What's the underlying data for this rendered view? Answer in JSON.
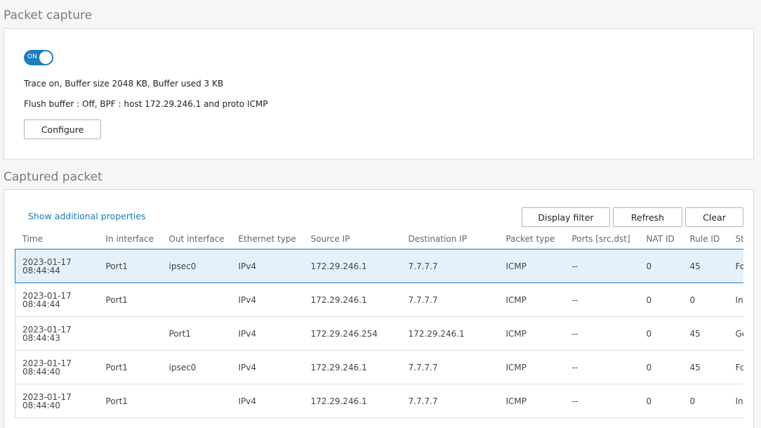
{
  "capture_section": {
    "title": "Packet capture",
    "toggle_label": "ON",
    "trace_status": "Trace on, Buffer size 2048 KB, Buffer used 3 KB",
    "buffer_status": "Flush buffer : Off, BPF : host 172.29.246.1 and proto ICMP",
    "configure_label": "Configure"
  },
  "captured_section": {
    "title": "Captured packet",
    "show_props_link": "Show additional properties",
    "display_filter_label": "Display filter",
    "refresh_label": "Refresh",
    "clear_label": "Clear",
    "columns": [
      "Time",
      "In interface",
      "Out interface",
      "Ethernet type",
      "Source IP",
      "Destination IP",
      "Packet type",
      "Ports [src,dst]",
      "NAT ID",
      "Rule ID",
      "Status"
    ],
    "rows": [
      {
        "date": "2023-01-17",
        "time": "08:44:44",
        "in": "Port1",
        "out": "ipsec0",
        "eth": "IPv4",
        "src": "172.29.246.1",
        "dst": "7.7.7.7",
        "ptype": "ICMP",
        "ports": "--",
        "nat": "0",
        "rule": "45",
        "status": "Forwarded"
      },
      {
        "date": "2023-01-17",
        "time": "08:44:44",
        "in": "Port1",
        "out": "",
        "eth": "IPv4",
        "src": "172.29.246.1",
        "dst": "7.7.7.7",
        "ptype": "ICMP",
        "ports": "--",
        "nat": "0",
        "rule": "0",
        "status": "Incoming"
      },
      {
        "date": "2023-01-17",
        "time": "08:44:43",
        "in": "",
        "out": "Port1",
        "eth": "IPv4",
        "src": "172.29.246.254",
        "dst": "172.29.246.1",
        "ptype": "ICMP",
        "ports": "--",
        "nat": "0",
        "rule": "45",
        "status": "Generated"
      },
      {
        "date": "2023-01-17",
        "time": "08:44:40",
        "in": "Port1",
        "out": "ipsec0",
        "eth": "IPv4",
        "src": "172.29.246.1",
        "dst": "7.7.7.7",
        "ptype": "ICMP",
        "ports": "--",
        "nat": "0",
        "rule": "45",
        "status": "Forwarded"
      },
      {
        "date": "2023-01-17",
        "time": "08:44:40",
        "in": "Port1",
        "out": "",
        "eth": "IPv4",
        "src": "172.29.246.1",
        "dst": "7.7.7.7",
        "ptype": "ICMP",
        "ports": "--",
        "nat": "0",
        "rule": "0",
        "status": "Incoming"
      }
    ]
  },
  "colors": {
    "accent": "#1c7ebf",
    "selected_row": "#e5f1fa",
    "link": "#1a7bb9"
  }
}
